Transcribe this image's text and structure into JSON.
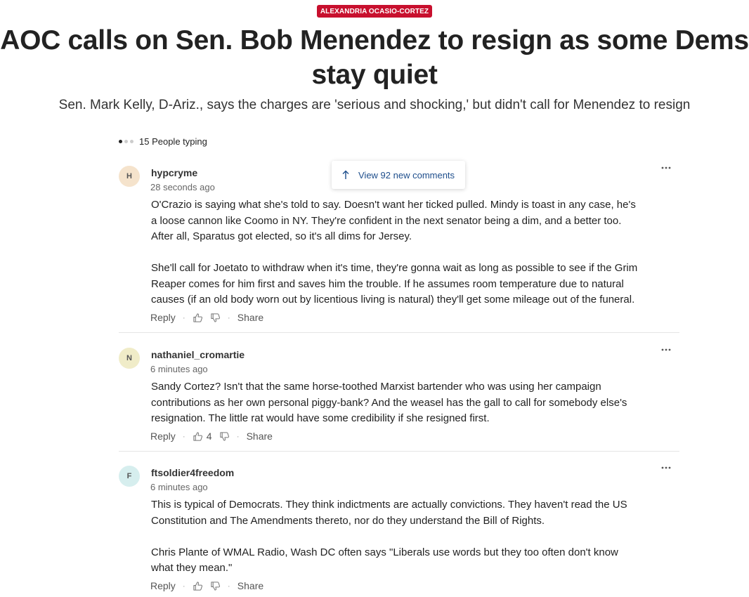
{
  "article": {
    "tag": "ALEXANDRIA OCASIO-CORTEZ",
    "headline_line1": "AOC calls on Sen. Bob Menendez to resign as some Dems",
    "headline_line2": "stay quiet",
    "subhead": "Sen. Mark Kelly, D-Ariz., says the charges are 'serious and shocking,' but didn't call for Menendez to resign"
  },
  "comments_section": {
    "typing_text": "15 People typing",
    "new_comments_label": "View 92 new comments",
    "reply_label": "Reply",
    "share_label": "Share",
    "items": [
      {
        "initial": "H",
        "avatar_color": "#f5e3cc",
        "username": "hypcryme",
        "time": "28 seconds ago",
        "para1_line1": "O'Crazio is saying what she's told to say.  Doesn't want her ticked pulled.  Mindy is toast in any case, he's",
        "para1_line2": "a loose cannon like Coomo in NY.  They're confident in the next senator being a dim, and a better too.",
        "para1_line3": "After all, Sparatus got elected, so it's all dims for Jersey.",
        "para2_line1": "She'll call for Joetato to withdraw when it's time, they're gonna wait as long as possible to see if the Grim",
        "para2_line2": "Reaper comes for him first and saves him the trouble.   If he assumes room temperature due to natural",
        "para2_line3": "causes (if an old body worn out by licentious living is natural) they'll get some mileage out of the funeral.",
        "likes": ""
      },
      {
        "initial": "N",
        "avatar_color": "#f0ecc8",
        "username": "nathaniel_cromartie",
        "time": "6 minutes ago",
        "para1_line1": "Sandy Cortez?  Isn't that the same horse-toothed Marxist bartender who was using her campaign",
        "para1_line2": "contributions as her own personal piggy-bank?  And the weasel has the gall to call for somebody else's",
        "para1_line3": "resignation.  The little rat would have some credibility if she resigned first.",
        "likes": "4"
      },
      {
        "initial": "F",
        "avatar_color": "#d6eeee",
        "username": "ftsoldier4freedom",
        "time": "6 minutes ago",
        "para1_line1": "This is typical of Democrats.  They think indictments are actually convictions.  They haven't read the US",
        "para1_line2": "Constitution and The Amendments thereto, nor do they understand the Bill of Rights.",
        "para2_line1": "Chris Plante of WMAL Radio, Wash DC often says \"Liberals use words but they too often don't know",
        "para2_line2": "what they mean.\"",
        "likes": ""
      }
    ]
  },
  "icons": {
    "more": "more-horizontal-icon",
    "like": "thumbs-up-icon",
    "dislike": "thumbs-down-icon",
    "arrow": "arrow-up-icon"
  },
  "colors": {
    "tag_bg": "#c8102e",
    "link": "#1e4e8c"
  }
}
